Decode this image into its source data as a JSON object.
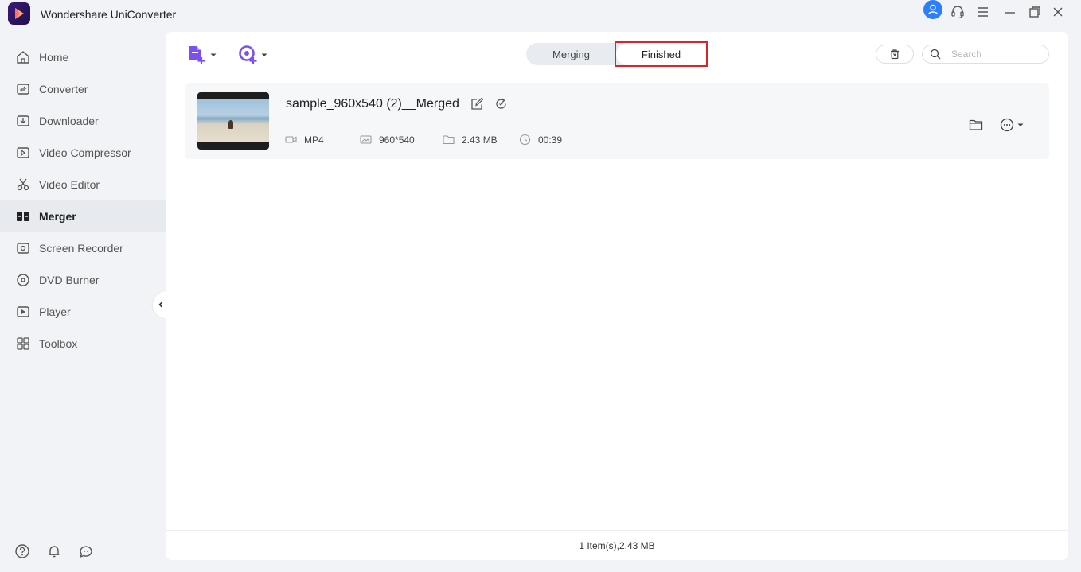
{
  "app": {
    "title": "Wondershare UniConverter"
  },
  "sidebar": {
    "items": [
      {
        "label": "Home",
        "icon": "home-icon"
      },
      {
        "label": "Converter",
        "icon": "converter-icon"
      },
      {
        "label": "Downloader",
        "icon": "download-icon"
      },
      {
        "label": "Video Compressor",
        "icon": "compress-icon"
      },
      {
        "label": "Video Editor",
        "icon": "scissors-icon"
      },
      {
        "label": "Merger",
        "icon": "merge-icon",
        "active": true
      },
      {
        "label": "Screen Recorder",
        "icon": "record-icon"
      },
      {
        "label": "DVD Burner",
        "icon": "disc-icon"
      },
      {
        "label": "Player",
        "icon": "play-icon"
      },
      {
        "label": "Toolbox",
        "icon": "grid-icon"
      }
    ]
  },
  "tabs": {
    "merging": "Merging",
    "finished": "Finished",
    "selected": "Finished"
  },
  "search": {
    "placeholder": "Search",
    "value": ""
  },
  "file": {
    "name": "sample_960x540 (2)__Merged",
    "format": "MP4",
    "resolution": "960*540",
    "size": "2.43 MB",
    "duration": "00:39"
  },
  "footer": {
    "summary": "1 Item(s),2.43 MB"
  },
  "colors": {
    "accent": "#7b4ff0",
    "highlight": "#d3262d",
    "avatar": "#2d7ff9"
  }
}
